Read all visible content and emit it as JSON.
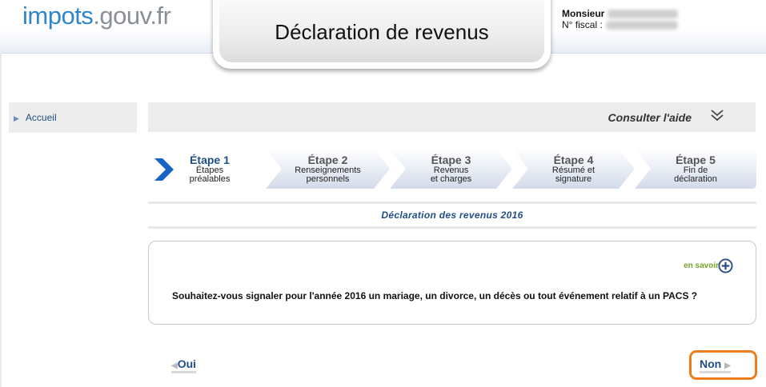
{
  "header": {
    "logo_part1": "impots",
    "logo_part2": ".gouv.fr",
    "page_title": "Déclaration de revenus",
    "user_title": "Monsieur",
    "fiscal_label": "N° fiscal :"
  },
  "sidebar": {
    "items": [
      {
        "label": "Accueil"
      }
    ]
  },
  "help": {
    "label": "Consulter l'aide"
  },
  "steps": [
    {
      "label": "Étape 1",
      "line1": "Étapes",
      "line2": "préalables",
      "active": true
    },
    {
      "label": "Étape 2",
      "line1": "Renseignements",
      "line2": "personnels",
      "active": false
    },
    {
      "label": "Étape 3",
      "line1": "Revenus",
      "line2": "et charges",
      "active": false
    },
    {
      "label": "Étape 4",
      "line1": "Résumé et",
      "line2": "signature",
      "active": false
    },
    {
      "label": "Étape 5",
      "line1": "Fin de",
      "line2": "déclaration",
      "active": false
    }
  ],
  "declaration_title": "Déclaration des revenus 2016",
  "question_box": {
    "en_savoir_label": "en savoir",
    "question": "Souhaitez-vous signaler pour l'année 2016 un mariage, un divorce, un décès ou tout événement relatif à un PACS ?"
  },
  "answers": {
    "yes_label": "Oui",
    "no_label": "Non"
  },
  "colors": {
    "brand_blue": "#2f86c8",
    "link_blue": "#1f4e86",
    "green": "#7aa32a",
    "highlight_orange": "#ef7c1a"
  }
}
